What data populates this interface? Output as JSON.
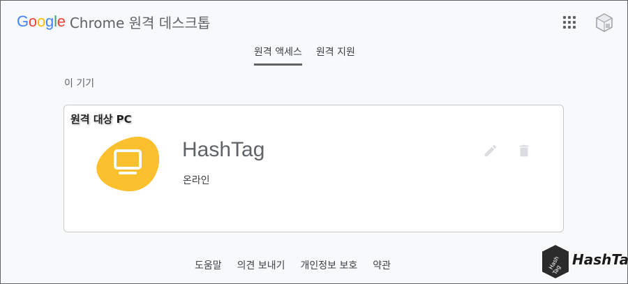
{
  "header": {
    "brand_letters": [
      "G",
      "o",
      "o",
      "g",
      "l",
      "e"
    ],
    "title_rest": "Chrome 원격 데스크톱"
  },
  "tabs": [
    {
      "label": "원격 액세스",
      "active": true
    },
    {
      "label": "원격 지원",
      "active": false
    }
  ],
  "section": {
    "label": "이 기기"
  },
  "card": {
    "tag": "원격 대상 PC",
    "device_name": "HashTag",
    "status": "온라인",
    "icon": "computer-icon",
    "accent": "#fbc02d"
  },
  "footer": {
    "links": [
      "도움말",
      "의견 보내기",
      "개인정보 보호",
      "약관"
    ]
  },
  "watermark": {
    "logo_text": "HashTag"
  }
}
